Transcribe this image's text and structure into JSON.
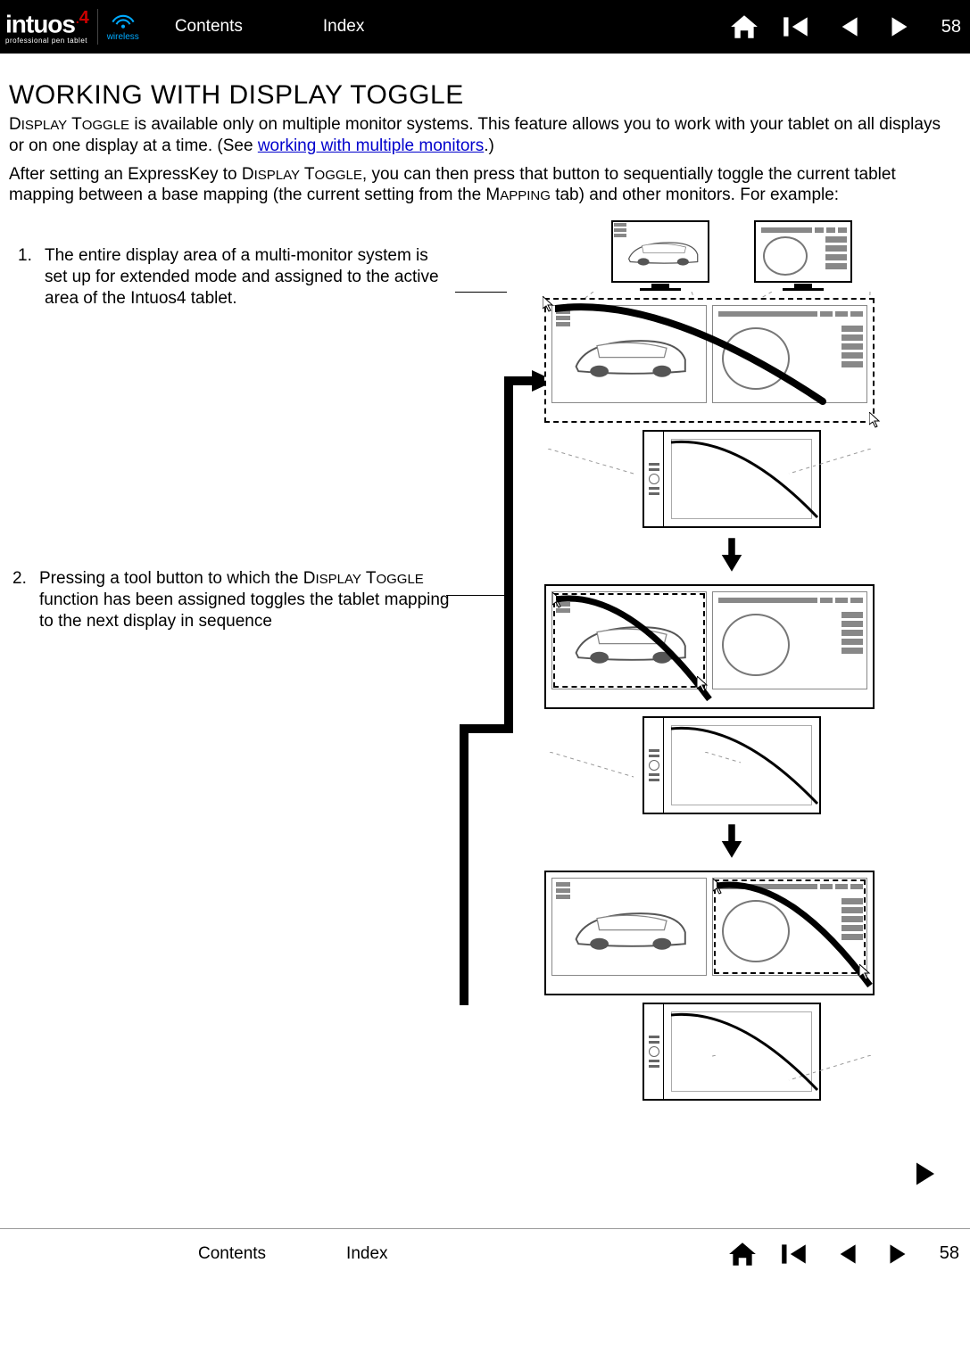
{
  "header": {
    "logo_main": "intuos",
    "logo_suffix": "4",
    "logo_sub": "professional pen tablet",
    "wireless_label": "wireless",
    "contents": "Contents",
    "index": "Index",
    "page": "58"
  },
  "title": "WORKING WITH DISPLAY TOGGLE",
  "intro_prefix": "D",
  "intro_sc1": "ISPLAY",
  "intro_mid1": " T",
  "intro_sc2": "OGGLE",
  "intro_rest": " is available only on multiple monitor systems.  This feature allows you to work with your tablet on all displays or on one display at a time.  (See ",
  "intro_link": "working with multiple monitors",
  "intro_end": ".)",
  "intro2_a": "After setting an ExpressKey to D",
  "intro2_sc1": "ISPLAY",
  "intro2_b": " T",
  "intro2_sc2": "OGGLE",
  "intro2_c": ", you can then press that button to sequentially toggle the current tablet mapping between a base mapping (the current setting from the M",
  "intro2_sc3": "APPING",
  "intro2_d": " tab) and other monitors.  For example:",
  "step1_num": "1.",
  "step1_txt": "The entire display area of a multi-monitor system is set up for extended mode and assigned to the active area of the Intuos4 tablet.",
  "step2_num": "2.",
  "step2_txt_a": "Pressing a tool button to which the D",
  "step2_sc1": "ISPLAY",
  "step2_txt_b": " T",
  "step2_sc2": "OGGLE",
  "step2_txt_c": " function has been assigned toggles the tablet mapping to the next display in sequence",
  "footer": {
    "contents": "Contents",
    "index": "Index",
    "page": "58"
  }
}
